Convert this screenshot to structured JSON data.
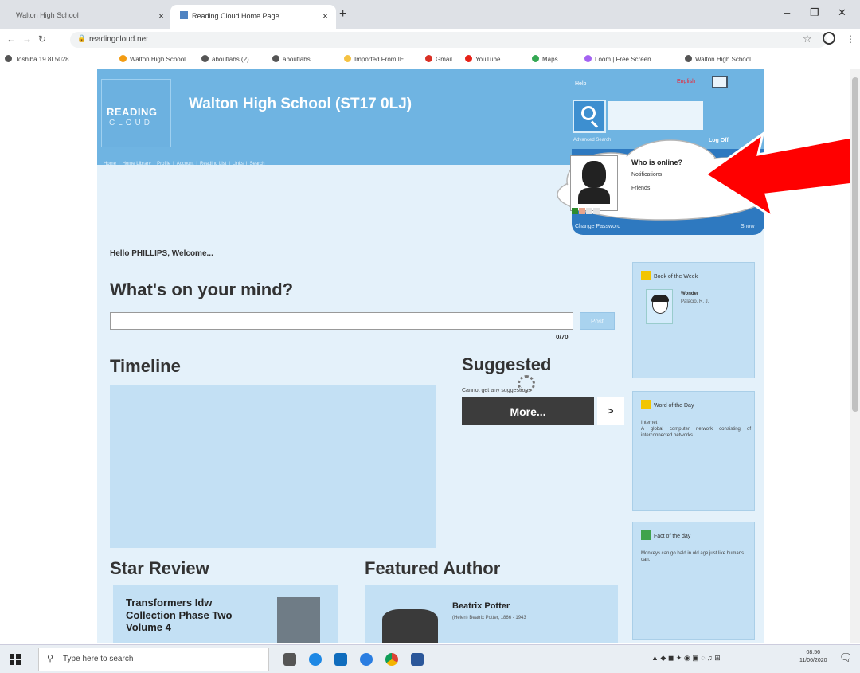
{
  "browser": {
    "tabs": [
      {
        "title": "Walton High School",
        "active": false
      },
      {
        "title": "Reading Cloud Home Page",
        "active": true
      }
    ],
    "new_tab": "+",
    "url": "readingcloud.net",
    "bookmarks": [
      {
        "label": "Toshiba 19.8L5028...",
        "color": "#555555"
      },
      {
        "label": "Walton High School",
        "color": "#f39c12"
      },
      {
        "label": "aboutlabs (2)",
        "color": "#555555"
      },
      {
        "label": "aboutlabs",
        "color": "#555555"
      },
      {
        "label": "Imported From IE",
        "color": "#f5c242"
      },
      {
        "label": "Gmail",
        "color": "#d93025"
      },
      {
        "label": "YouTube",
        "color": "#e62117"
      },
      {
        "label": "Maps",
        "color": "#34a853"
      },
      {
        "label": "Loom | Free Screen...",
        "color": "#a463f2"
      },
      {
        "label": "Walton High School",
        "color": "#555555"
      }
    ]
  },
  "site": {
    "logo_line1": "READING",
    "logo_line2": "CLOUD",
    "title": "Walton High School (ST17 0LJ)",
    "nav": [
      "Home",
      "|",
      "Home Library",
      "|",
      "Profile",
      "|",
      "Account",
      "|",
      "Reading List",
      "|",
      "Links",
      "|",
      "Search"
    ],
    "help": "Help",
    "language": "English",
    "search_placeholder": "",
    "advanced_search": "Advanced Search",
    "log_off": "Log Off",
    "online": {
      "title": "Who is online?",
      "notifications": "Notifications",
      "friends": "Friends",
      "change_password": "Change Password",
      "show": "Show"
    },
    "greeting": "Hello PHILLIPS, Welcome...",
    "mind_title": "What's on your mind?",
    "mind_value": "",
    "post_label": "Post",
    "char_count": "0/70",
    "timeline_title": "Timeline",
    "suggested_title": "Suggested",
    "suggested_msg": "Cannot get any suggestions",
    "more_label": "More...",
    "more_arrow": ">",
    "book_of_week": {
      "heading": "Book of the Week",
      "title": "Wonder",
      "author": "Palacio, R. J."
    },
    "word_of_day": {
      "heading": "Word of the Day",
      "word": "Internet",
      "definition": "A global computer network consisting of interconnected networks."
    },
    "fact_of_day": {
      "heading": "Fact of the day",
      "text": "Monkeys can go bald in old age just like humans can."
    },
    "star_review": {
      "title": "Star Review",
      "book": "Transformers Idw Collection Phase Two Volume 4"
    },
    "featured_author": {
      "title": "Featured Author",
      "name": "Beatrix Potter",
      "meta": "(Helen) Beatrix Potter, 1866 - 1943"
    }
  },
  "taskbar": {
    "search_placeholder": "Type here to search",
    "time": "08:56",
    "date": "11/06/2020"
  },
  "colors": {
    "header_blue": "#6fb4e2",
    "panel_blue": "#2e79c0",
    "page_blue": "#e4f1fa",
    "box_blue": "#c3e0f4",
    "arrow_red": "#ff0000"
  }
}
